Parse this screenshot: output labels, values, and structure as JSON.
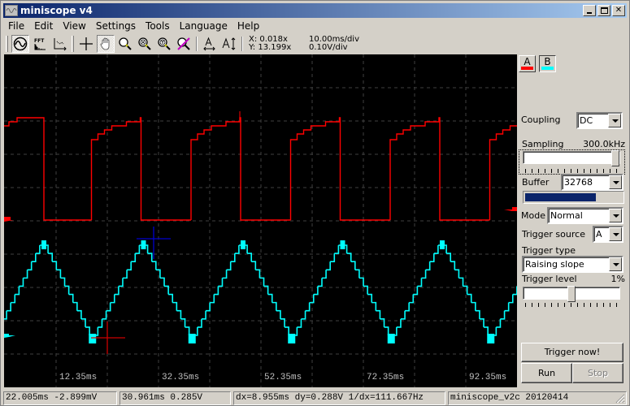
{
  "window": {
    "title": "miniscope v4",
    "controls": {
      "minimize": "_",
      "maximize": "□",
      "close": "✕"
    }
  },
  "menu": [
    "File",
    "Edit",
    "View",
    "Settings",
    "Tools",
    "Language",
    "Help"
  ],
  "toolbar": {
    "buttons": [
      {
        "name": "oscilloscope-mode",
        "icon": "sine-circle-icon",
        "pressed": true
      },
      {
        "name": "fft-mode",
        "icon": "fft-icon",
        "label": "FFT",
        "pressed": false
      },
      {
        "name": "xy-mode",
        "icon": "xy-plot-icon",
        "pressed": false
      },
      {
        "name": "cursor",
        "icon": "crosshair-icon",
        "pressed": false
      },
      {
        "name": "pan",
        "icon": "hand-icon",
        "pressed": true
      },
      {
        "name": "zoom",
        "icon": "magnifier-icon",
        "pressed": false
      },
      {
        "name": "zoom-x",
        "icon": "magnifier-x-icon",
        "pressed": false
      },
      {
        "name": "zoom-y",
        "icon": "magnifier-y-icon",
        "pressed": false
      },
      {
        "name": "zoom-reset",
        "icon": "magnifier-cancel-icon",
        "pressed": false
      },
      {
        "name": "autoscale-x",
        "icon": "autoscale-horizontal-icon",
        "pressed": false
      },
      {
        "name": "autoscale-y",
        "icon": "autoscale-vertical-icon",
        "pressed": false
      }
    ],
    "zoom_x": "X: 0.018x",
    "zoom_y": "Y: 13.199x",
    "time_div": "10.00ms/div",
    "volt_div": "0.10V/div"
  },
  "scope": {
    "background": "#000000",
    "grid_color": "#404040",
    "time_labels": [
      "12.35ms",
      "32.35ms",
      "52.35ms",
      "72.35ms",
      "92.35ms"
    ],
    "channel_a": {
      "color": "#ff0000",
      "waveform": "square",
      "period_ms": 22.0
    },
    "channel_b": {
      "color": "#00ffff",
      "waveform": "triangle",
      "period_ms": 22.0
    },
    "cursor_1": {
      "color": "#0000cc",
      "time": "30.961ms",
      "voltage": "0.285V"
    },
    "cursor_2": {
      "color": "#cc0000",
      "time": "22.005ms",
      "voltage": "-2.899mV"
    }
  },
  "side": {
    "channels": [
      {
        "label": "A",
        "color": "#ff0000",
        "active": false
      },
      {
        "label": "B",
        "color": "#00ffff",
        "active": true
      }
    ],
    "coupling": {
      "label": "Coupling",
      "value": "DC"
    },
    "sampling": {
      "label": "Sampling",
      "value": "300.0kHz",
      "slider_fraction": 1.0
    },
    "buffer": {
      "label": "Buffer",
      "value": "32768",
      "fill_fraction": 0.73
    },
    "mode": {
      "label": "Mode",
      "value": "Normal"
    },
    "trigger_source": {
      "label": "Trigger source",
      "value": "A"
    },
    "trigger_type": {
      "label": "Trigger type",
      "value": "Raising slope"
    },
    "trigger_level": {
      "label": "Trigger level",
      "value": "1%",
      "slider_fraction": 0.5
    },
    "trigger_now": "Trigger now!",
    "run": "Run",
    "stop": "Stop"
  },
  "status": [
    "22.005ms -2.899mV",
    "30.961ms 0.285V",
    "dx=8.955ms dy=0.288V 1/dx=111.667Hz",
    "miniscope_v2c 20120414"
  ]
}
